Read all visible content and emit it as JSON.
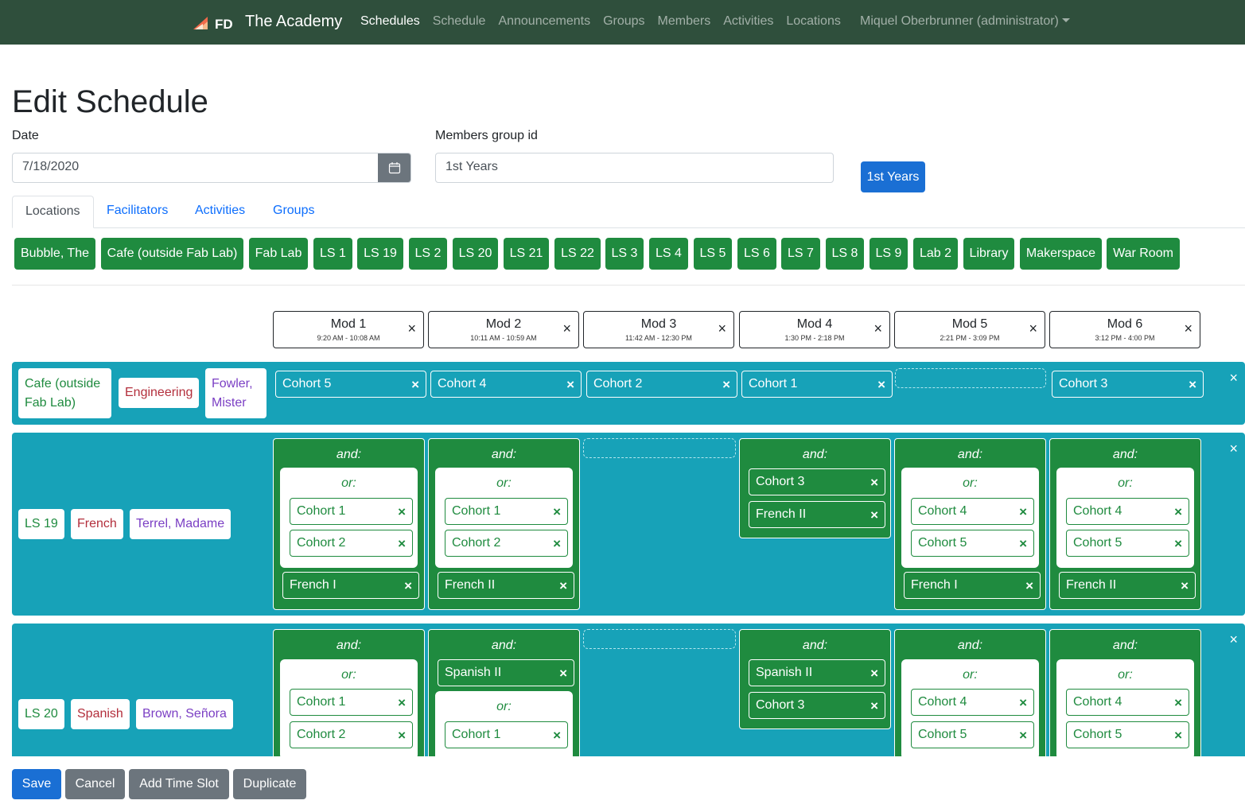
{
  "nav": {
    "brand": "The Academy",
    "links": [
      "Schedules",
      "Schedule",
      "Announcements",
      "Groups",
      "Members",
      "Activities",
      "Locations"
    ],
    "user": "Miquel Oberbrunner (administrator)"
  },
  "page": {
    "title": "Edit Schedule",
    "date_label": "Date",
    "date_value": "7/18/2020",
    "group_label": "Members group id",
    "group_value": "1st Years",
    "group_badge": "1st Years"
  },
  "tabs": [
    "Locations",
    "Facilitators",
    "Activities",
    "Groups"
  ],
  "locations": [
    "Bubble, The",
    "Cafe (outside Fab Lab)",
    "Fab Lab",
    "LS 1",
    "LS 19",
    "LS 2",
    "LS 20",
    "LS 21",
    "LS 22",
    "LS 3",
    "LS 4",
    "LS 5",
    "LS 6",
    "LS 7",
    "LS 8",
    "LS 9",
    "Lab 2",
    "Library",
    "Makerspace",
    "War Room"
  ],
  "mods": [
    {
      "name": "Mod 1",
      "time": "9:20 AM - 10:08 AM"
    },
    {
      "name": "Mod 2",
      "time": "10:11 AM - 10:59 AM"
    },
    {
      "name": "Mod 3",
      "time": "11:42 AM - 12:30 PM"
    },
    {
      "name": "Mod 4",
      "time": "1:30 PM - 2:18 PM"
    },
    {
      "name": "Mod 5",
      "time": "2:21 PM - 3:09 PM"
    },
    {
      "name": "Mod 6",
      "time": "3:12 PM - 4:00 PM"
    }
  ],
  "rows": [
    {
      "location": "Cafe (outside Fab Lab)",
      "activity": "Engineering",
      "facilitator": "Fowler, Mister",
      "cells": [
        "Cohort 5",
        "Cohort 4",
        "Cohort 2",
        "Cohort 1",
        "",
        "Cohort 3"
      ]
    },
    {
      "location": "LS 19",
      "activity": "French",
      "facilitator": "Terrel, Madame",
      "cells": [
        {
          "and": "and:",
          "or": "or:",
          "or_items": [
            "Cohort 1",
            "Cohort 2"
          ],
          "item": "French I"
        },
        {
          "and": "and:",
          "or": "or:",
          "or_items": [
            "Cohort 1",
            "Cohort 2"
          ],
          "item": "French II"
        },
        null,
        {
          "and": "and:",
          "items": [
            "Cohort 3",
            "French II"
          ]
        },
        {
          "and": "and:",
          "or": "or:",
          "or_items": [
            "Cohort 4",
            "Cohort 5"
          ],
          "item": "French I"
        },
        {
          "and": "and:",
          "or": "or:",
          "or_items": [
            "Cohort 4",
            "Cohort 5"
          ],
          "item": "French II"
        }
      ]
    },
    {
      "location": "LS 20",
      "activity": "Spanish",
      "facilitator": "Brown, Señora",
      "cells": [
        {
          "and": "and:",
          "or": "or:",
          "or_items": [
            "Cohort 1",
            "Cohort 2"
          ]
        },
        {
          "and": "and:",
          "item": "Spanish II",
          "or": "or:",
          "or_items": [
            "Cohort 1"
          ]
        },
        null,
        {
          "and": "and:",
          "items": [
            "Spanish II",
            "Cohort 3"
          ]
        },
        {
          "and": "and:",
          "or": "or:",
          "or_items": [
            "Cohort 4",
            "Cohort 5"
          ]
        },
        {
          "and": "and:",
          "or": "or:",
          "or_items": [
            "Cohort 4",
            "Cohort 5"
          ]
        }
      ]
    }
  ],
  "buttons": {
    "save": "Save",
    "cancel": "Cancel",
    "add": "Add Time Slot",
    "duplicate": "Duplicate"
  },
  "icons": {
    "close": "×"
  },
  "colors": {
    "nav": "#2f4f3c",
    "green": "#1f8b3f",
    "teal": "#17a2b8",
    "primary": "#1a6fd4",
    "secondary": "#6c757d"
  }
}
